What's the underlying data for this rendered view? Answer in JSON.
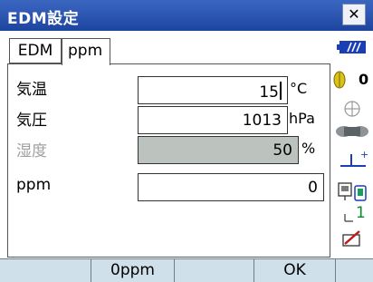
{
  "window": {
    "title": "EDM設定",
    "close_label": "✕"
  },
  "tabs": [
    {
      "label": "EDM",
      "active": false
    },
    {
      "label": "ppm",
      "active": true
    }
  ],
  "form": {
    "rows": [
      {
        "label": "気温",
        "value": "15",
        "unit": "°C",
        "enabled": true
      },
      {
        "label": "気圧",
        "value": "1013",
        "unit": "hPa",
        "enabled": true
      },
      {
        "label": "湿度",
        "value": "50",
        "unit": "%",
        "enabled": false
      },
      {
        "label": "ppm",
        "value": "0",
        "unit": "",
        "enabled": true
      }
    ]
  },
  "status": {
    "battery_color": "#1a3fb5",
    "prism_constant": "0",
    "signal_count": "1",
    "accent": "#1a3fb5"
  },
  "softkeys": [
    "",
    "0ppm",
    "",
    "OK",
    ""
  ]
}
